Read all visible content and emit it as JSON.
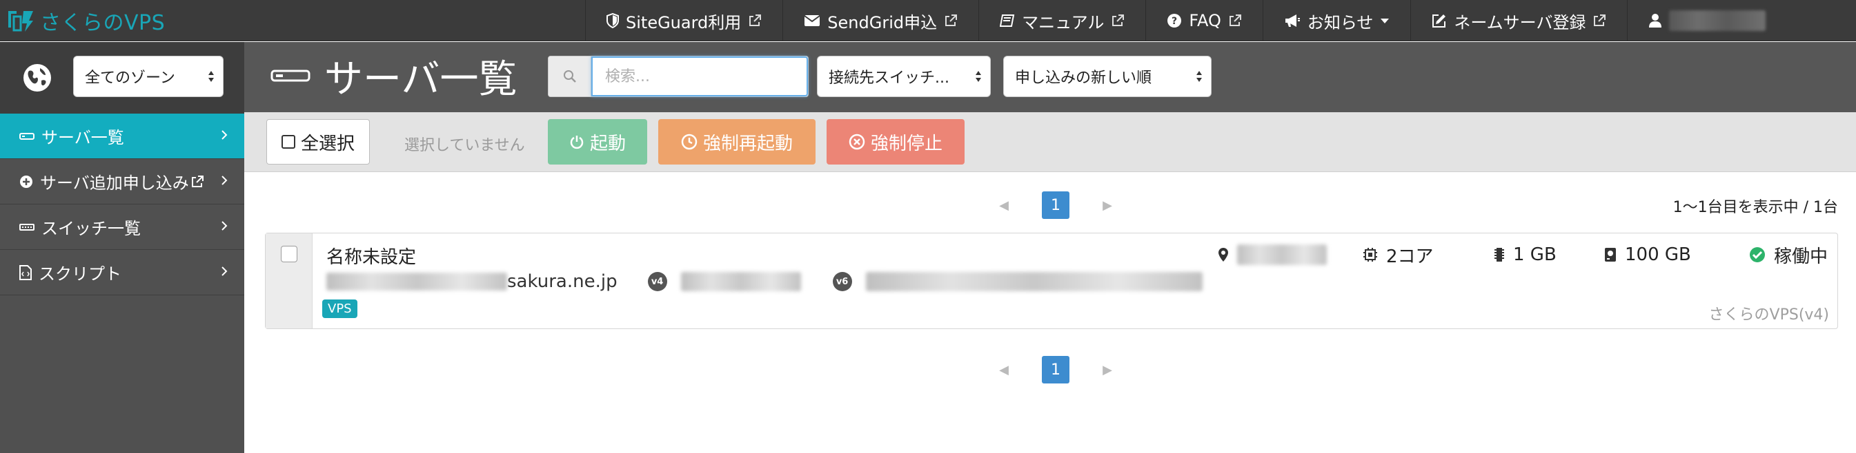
{
  "brand": {
    "name": "さくらのVPS",
    "color": "#19a6b7"
  },
  "nav": {
    "items": [
      {
        "label": "SiteGuard利用",
        "icon": "shield-icon",
        "external": true
      },
      {
        "label": "SendGrid申込",
        "icon": "envelope-icon",
        "external": true
      },
      {
        "label": "マニュアル",
        "icon": "book-icon",
        "external": true
      },
      {
        "label": "FAQ",
        "icon": "question-circle-icon",
        "external": true
      },
      {
        "label": "お知らせ",
        "icon": "bullhorn-icon",
        "dropdown": true
      },
      {
        "label": "ネームサーバ登録",
        "icon": "edit-icon",
        "external": true
      }
    ],
    "user_icon": "user-icon"
  },
  "sidebar": {
    "zone_select": {
      "value": "全てのゾーン",
      "icon": "globe-icon"
    },
    "items": [
      {
        "label": "サーバ一覧",
        "icon": "server-icon",
        "active": true
      },
      {
        "label": "サーバ追加申し込み",
        "icon": "plus-circle-icon",
        "external": true
      },
      {
        "label": "スイッチ一覧",
        "icon": "switch-icon"
      },
      {
        "label": "スクリプト",
        "icon": "script-icon"
      }
    ]
  },
  "header": {
    "title": "サーバ一覧",
    "search_placeholder": "検索...",
    "switch_select": "接続先スイッチ...",
    "sort_select": "申し込みの新しい順"
  },
  "actions": {
    "select_all": "全選択",
    "no_selection": "選択していません",
    "start": "起動",
    "reboot": "強制再起動",
    "stop": "強制停止",
    "colors": {
      "start": "#7ec9a1",
      "reboot": "#eea36b",
      "stop": "#ec8576"
    }
  },
  "pagination": {
    "current": "1",
    "range_text": "1〜1台目を表示中 / 1台"
  },
  "servers": [
    {
      "name": "名称未設定",
      "host_suffix": "sakura.ne.jp",
      "ipv4_label": "v4",
      "ipv6_label": "v6",
      "badge": "VPS",
      "cpu": "2コア",
      "memory": "1 GB",
      "disk": "100 GB",
      "status": "稼働中",
      "status_color": "#2db36a",
      "plan": "さくらのVPS(v4)"
    }
  ]
}
